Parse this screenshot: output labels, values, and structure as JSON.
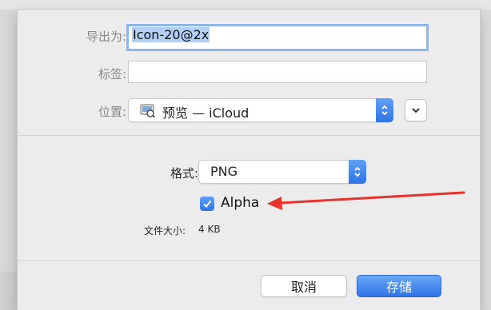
{
  "form": {
    "export_as_label": "导出为:",
    "export_as_value": "Icon-20@2x",
    "tags_label": "标签:",
    "tags_value": "",
    "location_label": "位置:",
    "location_value": "预览 — iCloud"
  },
  "options": {
    "format_label": "格式:",
    "format_value": "PNG",
    "alpha_label": "Alpha",
    "alpha_checked": true,
    "file_size_label": "文件大小:",
    "file_size_value": "4 KB"
  },
  "buttons": {
    "cancel": "取消",
    "save": "存储"
  },
  "colors": {
    "accent": "#2f73e6",
    "annotation_arrow": "#e8322c"
  }
}
